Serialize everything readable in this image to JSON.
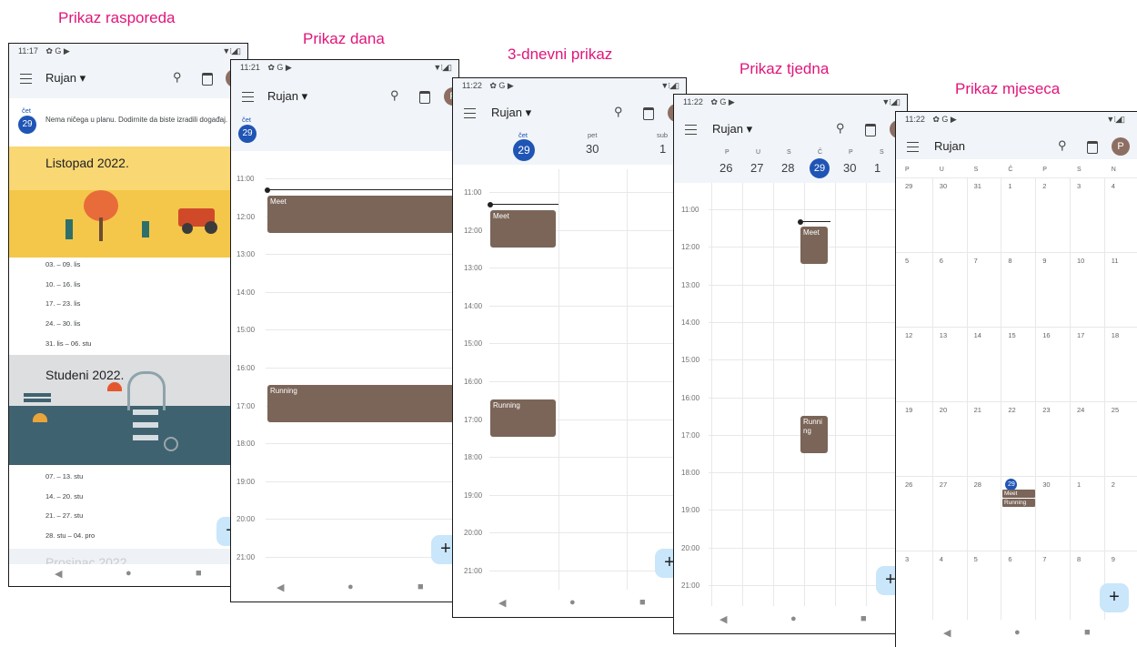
{
  "captions": {
    "schedule": "Prikaz rasporeda",
    "day": "Prikaz dana",
    "three_day": "3-dnevni prikaz",
    "week": "Prikaz tjedna",
    "month": "Prikaz mjeseca"
  },
  "status_times": [
    "11:17",
    "11:21",
    "11:22",
    "11:22",
    "11:22"
  ],
  "status_icons": "✿ G ▶",
  "app": {
    "month_label": "Rujan ▾",
    "month_label_plain": "Rujan",
    "avatar_letter": "P",
    "fab_label": "+"
  },
  "schedule": {
    "day_abbr": "čet",
    "day_num": "29",
    "empty_text": "Nema ničega u planu. Dodirnite da biste izradili događaj.",
    "october_banner": "Listopad 2022.",
    "october_weeks": [
      "03. – 09. lis",
      "10. – 16. lis",
      "17. – 23. lis",
      "24. – 30. lis",
      "31. lis – 06. stu"
    ],
    "november_banner": "Studeni 2022.",
    "november_weeks": [
      "07. – 13. stu",
      "14. – 20. stu",
      "21. – 27. stu",
      "28. stu – 04. pro"
    ],
    "december_banner": "Prosinac 2022."
  },
  "day_view": {
    "day_abbr": "čet",
    "day_num": "29",
    "hours": [
      "11:00",
      "12:00",
      "13:00",
      "14:00",
      "15:00",
      "16:00",
      "17:00",
      "18:00",
      "19:00",
      "20:00",
      "21:00"
    ],
    "events": [
      "Meet",
      "Running"
    ]
  },
  "three_day": {
    "days": [
      {
        "abbr": "čet",
        "num": "29"
      },
      {
        "abbr": "pet",
        "num": "30"
      },
      {
        "abbr": "sub",
        "num": "1"
      }
    ],
    "hours": [
      "11:00",
      "12:00",
      "13:00",
      "14:00",
      "15:00",
      "16:00",
      "17:00",
      "18:00",
      "19:00",
      "20:00",
      "21:00"
    ],
    "events": [
      "Meet",
      "Running"
    ]
  },
  "week_view": {
    "letters": [
      "P",
      "U",
      "S",
      "Č",
      "P",
      "S"
    ],
    "nums": [
      "26",
      "27",
      "28",
      "29",
      "30",
      "1"
    ],
    "hours": [
      "11:00",
      "12:00",
      "13:00",
      "14:00",
      "15:00",
      "16:00",
      "17:00",
      "18:00",
      "19:00",
      "20:00",
      "21:00"
    ],
    "events": [
      "Meet",
      "Running"
    ]
  },
  "month_view": {
    "weekdays": [
      "P",
      "U",
      "S",
      "Č",
      "P",
      "S",
      "N"
    ],
    "rows": [
      [
        "29",
        "30",
        "31",
        "1",
        "2",
        "3",
        "4"
      ],
      [
        "5",
        "6",
        "7",
        "8",
        "9",
        "10",
        "11"
      ],
      [
        "12",
        "13",
        "14",
        "15",
        "16",
        "17",
        "18"
      ],
      [
        "19",
        "20",
        "21",
        "22",
        "23",
        "24",
        "25"
      ],
      [
        "26",
        "27",
        "28",
        "29",
        "30",
        "1",
        "2"
      ],
      [
        "3",
        "4",
        "5",
        "6",
        "7",
        "8",
        "9"
      ]
    ],
    "today": "29",
    "events": [
      "Meet",
      "Running"
    ]
  },
  "nav": {
    "back": "◀",
    "home": "●",
    "recent": "■"
  }
}
